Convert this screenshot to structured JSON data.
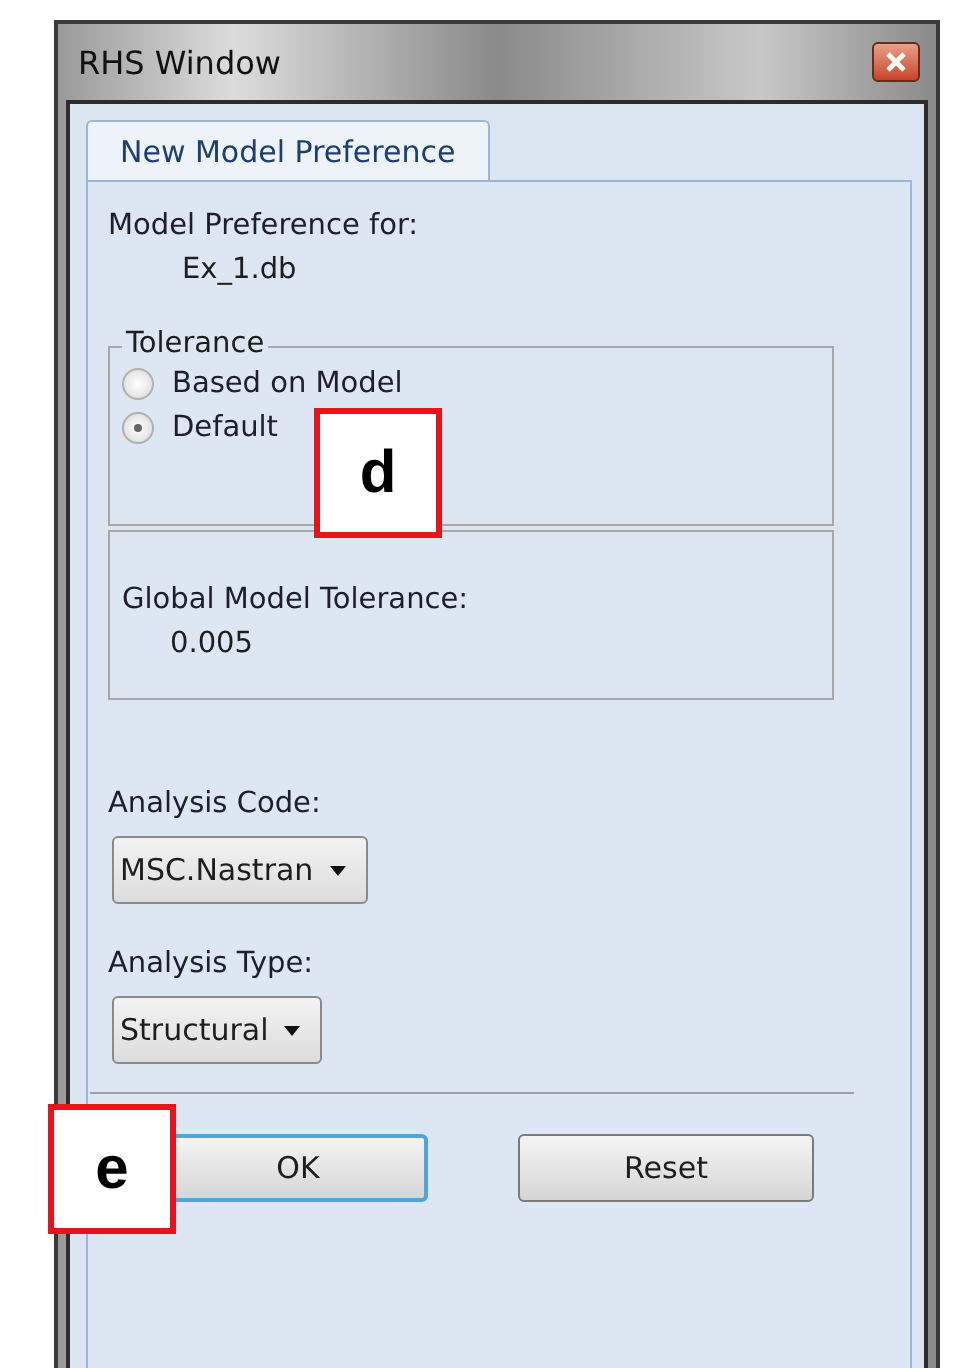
{
  "window": {
    "title": "RHS Window"
  },
  "tabs": [
    {
      "label": "New Model Preference",
      "selected": true
    }
  ],
  "model_preference": {
    "label": "Model Preference for:",
    "value": "Ex_1.db"
  },
  "tolerance": {
    "legend": "Tolerance",
    "callout": "d",
    "options": [
      {
        "label": "Based on Model",
        "selected": false
      },
      {
        "label": "Default",
        "selected": true
      }
    ]
  },
  "global_tolerance": {
    "label": "Global Model Tolerance:",
    "value": "0.005"
  },
  "analysis_code": {
    "label": "Analysis Code:",
    "value": "MSC.Nastran"
  },
  "analysis_type": {
    "label": "Analysis Type:",
    "value": "Structural"
  },
  "buttons": [
    {
      "label": "OK",
      "focused": true
    },
    {
      "label": "Reset",
      "focused": false
    }
  ],
  "buttons_callout": "e"
}
